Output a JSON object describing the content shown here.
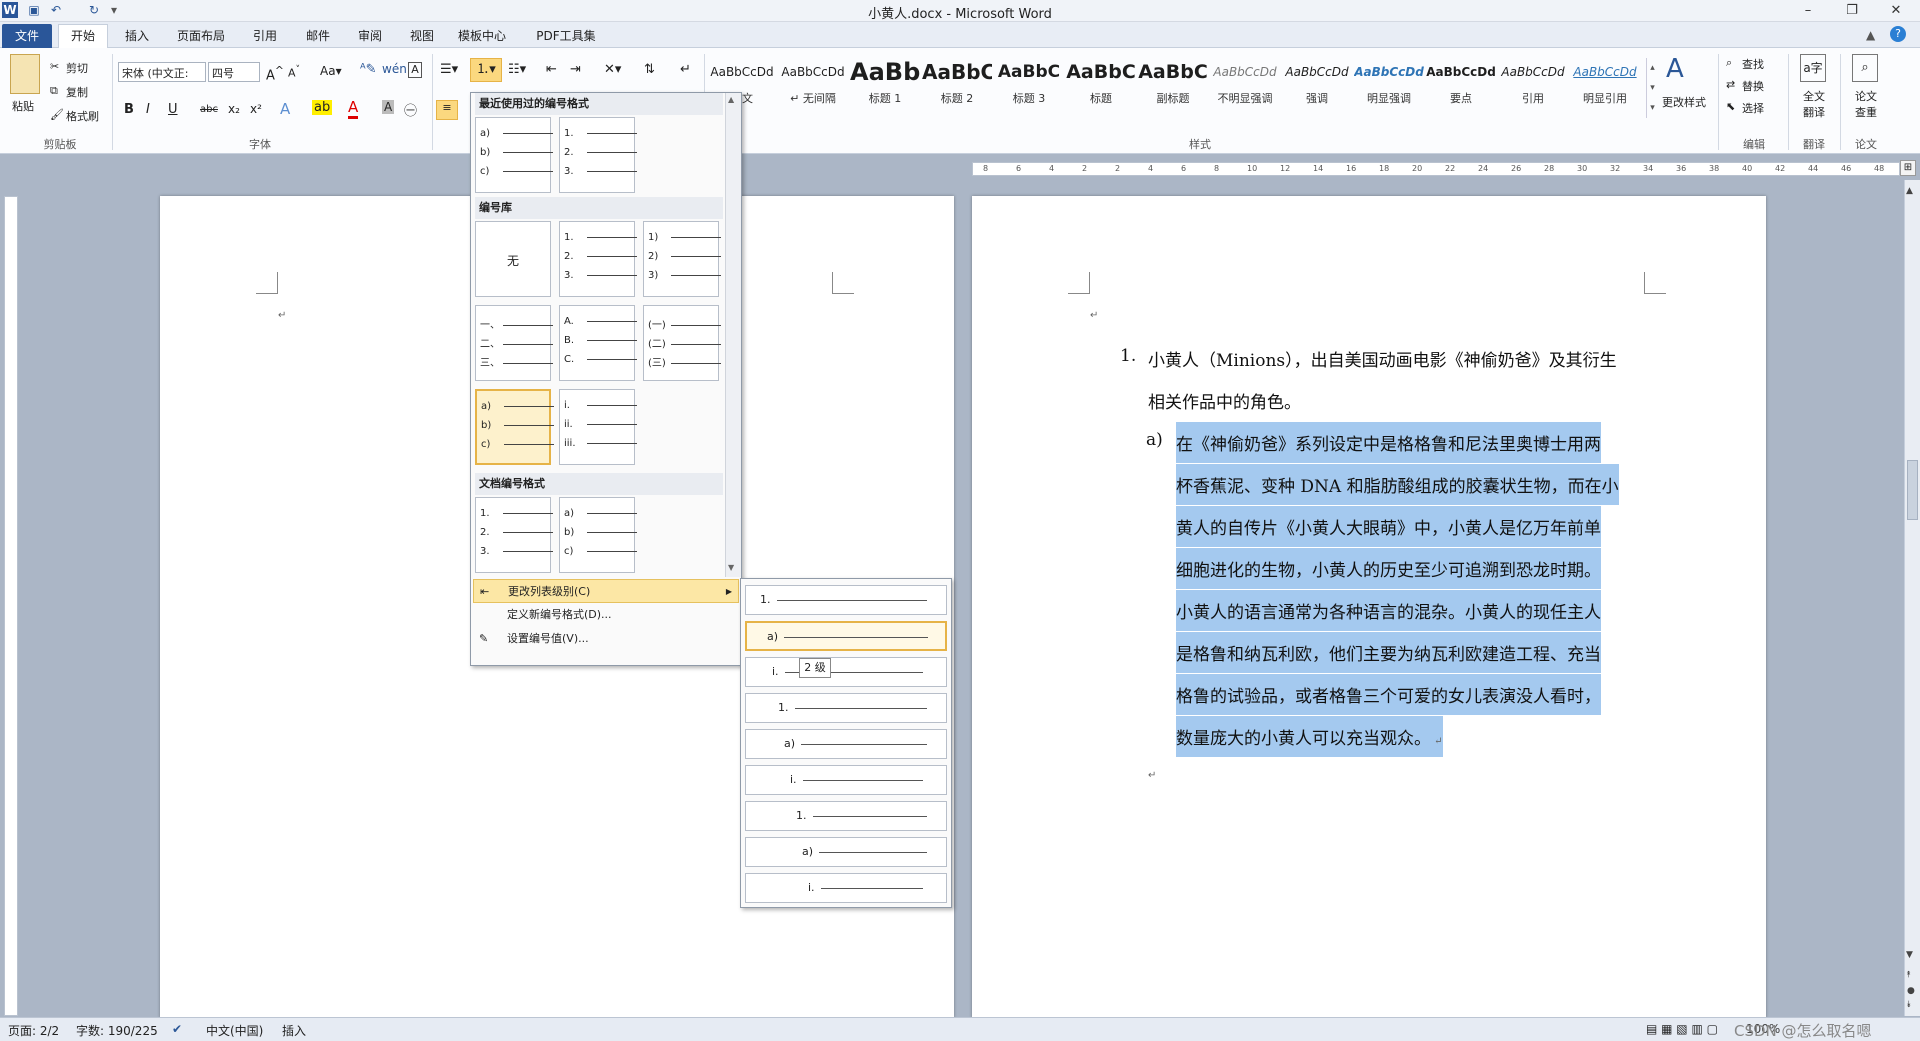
{
  "window": {
    "title": "小黄人.docx - Microsoft Word"
  },
  "tabs": [
    "文件",
    "开始",
    "插入",
    "页面布局",
    "引用",
    "邮件",
    "审阅",
    "视图",
    "模板中心",
    "PDF工具集"
  ],
  "clipboard": {
    "paste": "粘贴",
    "cut": "剪切",
    "copy": "复制",
    "format_painter": "格式刷",
    "label": "剪贴板"
  },
  "font": {
    "name": "宋体 (中文正:",
    "size": "四号",
    "label": "字体"
  },
  "paragraph": {
    "label": "段落"
  },
  "styles": {
    "items": [
      {
        "preview": "AaBbCcDd",
        "name": "正文"
      },
      {
        "preview": "AaBbCcDd",
        "name": "↵ 无间隔"
      },
      {
        "preview": "AaBb",
        "name": "标题 1"
      },
      {
        "preview": "AaBbC",
        "name": "标题 2"
      },
      {
        "preview": "AaBbC",
        "name": "标题 3"
      },
      {
        "preview": "AaBbC",
        "name": "标题"
      },
      {
        "preview": "AaBbC",
        "name": "副标题"
      },
      {
        "preview": "AaBbCcDd",
        "name": "不明显强调"
      },
      {
        "preview": "AaBbCcDd",
        "name": "强调"
      },
      {
        "preview": "AaBbCcDd",
        "name": "明显强调"
      },
      {
        "preview": "AaBbCcDd",
        "name": "要点"
      },
      {
        "preview": "AaBbCcDd",
        "name": "引用"
      },
      {
        "preview": "AaBbCcDd",
        "name": "明显引用"
      }
    ],
    "change_styles": "更改样式",
    "label": "样式"
  },
  "editing": {
    "find": "查找",
    "replace": "替换",
    "select": "选择",
    "label": "编辑"
  },
  "translate": {
    "btn": "全文翻译",
    "label": "翻译"
  },
  "thesis": {
    "btn": "论文查重",
    "label": "论文"
  },
  "ruler_ticks": [
    "8",
    "6",
    "4",
    "2",
    "2",
    "4",
    "6",
    "8",
    "10",
    "12",
    "14",
    "16",
    "18",
    "20",
    "22",
    "24",
    "26",
    "28",
    "30",
    "32",
    "34",
    "36",
    "38",
    "40",
    "42",
    "44",
    "46",
    "48"
  ],
  "dropdown": {
    "recent_header": "最近使用过的编号格式",
    "library_header": "编号库",
    "doc_header": "文档编号格式",
    "none_label": "无",
    "tiles_recent": [
      [
        "a)",
        "b)",
        "c)"
      ],
      [
        "1.",
        "2.",
        "3."
      ]
    ],
    "tiles_library": [
      [
        "1.",
        "2.",
        "3."
      ],
      [
        "1)",
        "2)",
        "3)"
      ],
      [
        "一、",
        "二、",
        "三、"
      ],
      [
        "A.",
        "B.",
        "C."
      ],
      [
        "(一)",
        "(二)",
        "(三)"
      ],
      [
        "a)",
        "b)",
        "c)"
      ],
      [
        "i.",
        "ii.",
        "iii."
      ]
    ],
    "tiles_doc": [
      [
        "1.",
        "2.",
        "3."
      ],
      [
        "a)",
        "b)",
        "c)"
      ]
    ],
    "menu_change_level": "更改列表级别(C)",
    "menu_define": "定义新编号格式(D)...",
    "menu_set_value": "设置编号值(V)..."
  },
  "submenu": {
    "levels": [
      "1.",
      "a)",
      "i.",
      "1.",
      "a)",
      "i.",
      "1.",
      "a)",
      "i."
    ],
    "tooltip": "2 级"
  },
  "document": {
    "item1_num": "1.",
    "item1_line1": "小黄人（Minions），出自美国动画电影《神偷奶爸》及其衍生",
    "item1_line2": "相关作品中的角色。",
    "sub_num": "a)",
    "sub_lines": [
      "在《神偷奶爸》系列设定中是格格鲁和尼法里奥博士用两",
      "杯香蕉泥、变种 DNA 和脂肪酸组成的胶囊状生物，而在小",
      "黄人的自传片《小黄人大眼萌》中，小黄人是亿万年前单",
      "细胞进化的生物，小黄人的历史至少可追溯到恐龙时期。",
      "小黄人的语言通常为各种语言的混杂。小黄人的现任主人",
      "是格鲁和纳瓦利欧，他们主要为纳瓦利欧建造工程、充当",
      "格鲁的试验品，或者格鲁三个可爱的女儿表演没人看时，",
      "数量庞大的小黄人可以充当观众。"
    ]
  },
  "status": {
    "page": "页面: 2/2",
    "words": "字数: 190/225",
    "lang": "中文(中国)",
    "mode": "插入",
    "zoom": "100%",
    "watermark": "CSDN @怎么取名嗯"
  }
}
